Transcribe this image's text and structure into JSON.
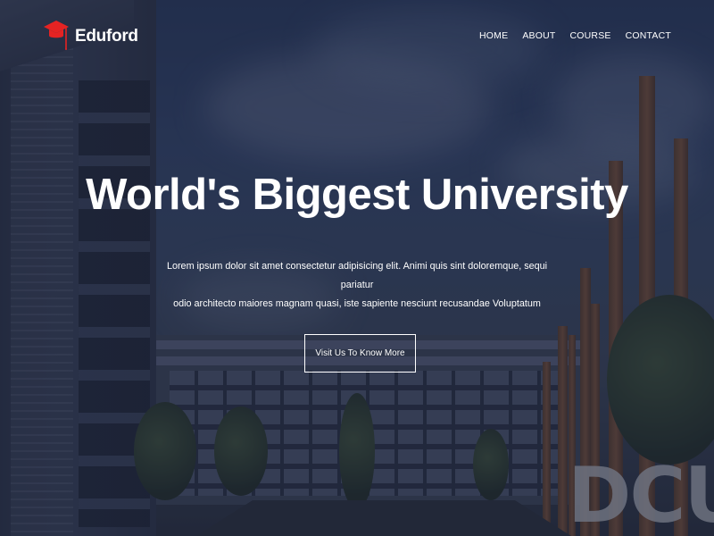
{
  "brand": {
    "name": "Eduford",
    "icon": "graduation-cap-icon",
    "accent": "#e52323"
  },
  "nav": {
    "items": [
      "HOME",
      "ABOUT",
      "COURSE",
      "CONTACT"
    ]
  },
  "hero": {
    "title": "World's Biggest University",
    "lead_line1": "Lorem ipsum dolor sit amet consectetur adipisicing elit. Animi quis sint doloremque, sequi pariatur",
    "lead_line2": "odio architecto maiores magnam quasi, iste sapiente nesciunt recusandae Voluptatum",
    "cta_label": "Visit Us To Know More",
    "background_sign": "DCU"
  }
}
